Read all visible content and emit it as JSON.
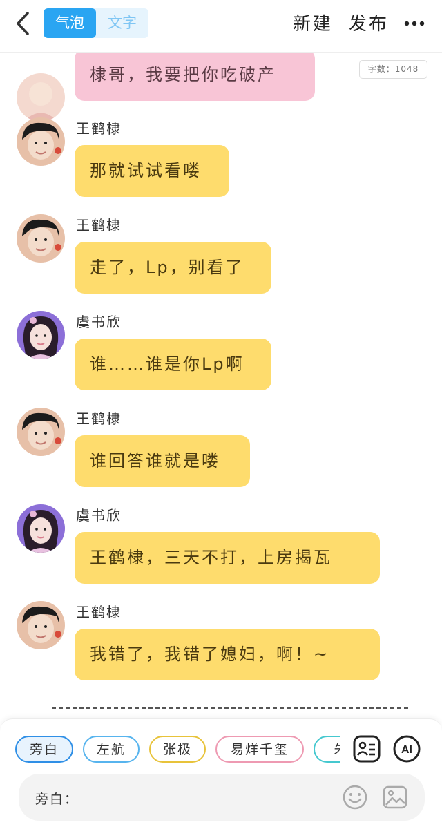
{
  "topbar": {
    "tabs": [
      "气泡",
      "文字"
    ],
    "new_label": "新建",
    "publish_label": "发布"
  },
  "word_count": "字数：1048",
  "messages": [
    {
      "sender": "",
      "text": "棣哥，我要把你吃破产",
      "style": "pink"
    },
    {
      "sender": "王鹤棣",
      "text": "那就试试看喽",
      "style": "yellow"
    },
    {
      "sender": "王鹤棣",
      "text": "走了，Lp，别看了",
      "style": "yellow"
    },
    {
      "sender": "虞书欣",
      "text": "谁……谁是你Lp啊",
      "style": "yellow"
    },
    {
      "sender": "王鹤棣",
      "text": "谁回答谁就是喽",
      "style": "yellow"
    },
    {
      "sender": "虞书欣",
      "text": "王鹤棣，三天不打，上房揭瓦",
      "style": "yellow"
    },
    {
      "sender": "王鹤棣",
      "text": "我错了，我错了媳妇，啊！~",
      "style": "yellow"
    }
  ],
  "roles": [
    "旁白",
    "左航",
    "张极",
    "易烊千玺",
    "朱"
  ],
  "input": {
    "label": "旁白：",
    "value": ""
  },
  "icons": {
    "back": "chevron-left-icon",
    "more": "more-horizontal-icon",
    "role_card": "role-card-icon",
    "ai": "ai-icon",
    "emoji": "emoji-icon",
    "image": "image-icon"
  },
  "colors": {
    "accent_blue": "#2aa5f2",
    "bubble_yellow": "#fedc6d",
    "bubble_pink": "#f8c5d6"
  }
}
